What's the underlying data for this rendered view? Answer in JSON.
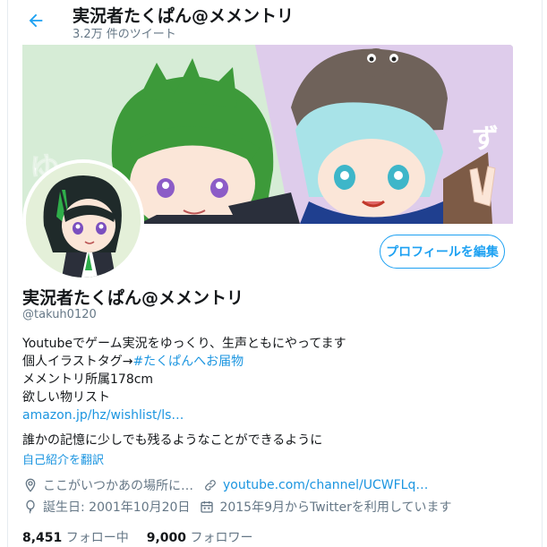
{
  "header": {
    "back_icon": "arrow-left-icon",
    "title": "実況者たくぱん@メメントリ",
    "tweet_count": "3.2万 件のツイート"
  },
  "banner": {
    "text_left": "ゆっ",
    "text_right": "ず"
  },
  "profile": {
    "edit_button": "プロフィールを編集",
    "name": "実況者たくぱん@メメントリ",
    "handle": "@takuh0120"
  },
  "bio": {
    "line1": "Youtubeでゲーム実況をゆっくり、生声ともにやってます",
    "line2_prefix": "個人イラストタグ→",
    "line2_hashtag": "#たくぱんへお届物",
    "line3": "メメントリ所属178cm",
    "line4": "欲しい物リスト",
    "line5_link": "amazon.jp/hz/wishlist/ls…",
    "line6": "誰かの記憶に少しでも残るようなことができるように",
    "translate": "自己紹介を翻訳"
  },
  "meta": {
    "location": "ここがいつかあの場所に…",
    "website": "youtube.com/channel/UCWFLq…",
    "birthday": "誕生日: 2001年10月20日",
    "joined": "2015年9月からTwitterを利用しています"
  },
  "stats": {
    "following_count": "8,451",
    "following_label": "フォロー中",
    "followers_count": "9,000",
    "followers_label": "フォロワー"
  },
  "colors": {
    "accent": "#1da1f2",
    "link": "#1b95e0",
    "secondary_text": "#657786"
  }
}
